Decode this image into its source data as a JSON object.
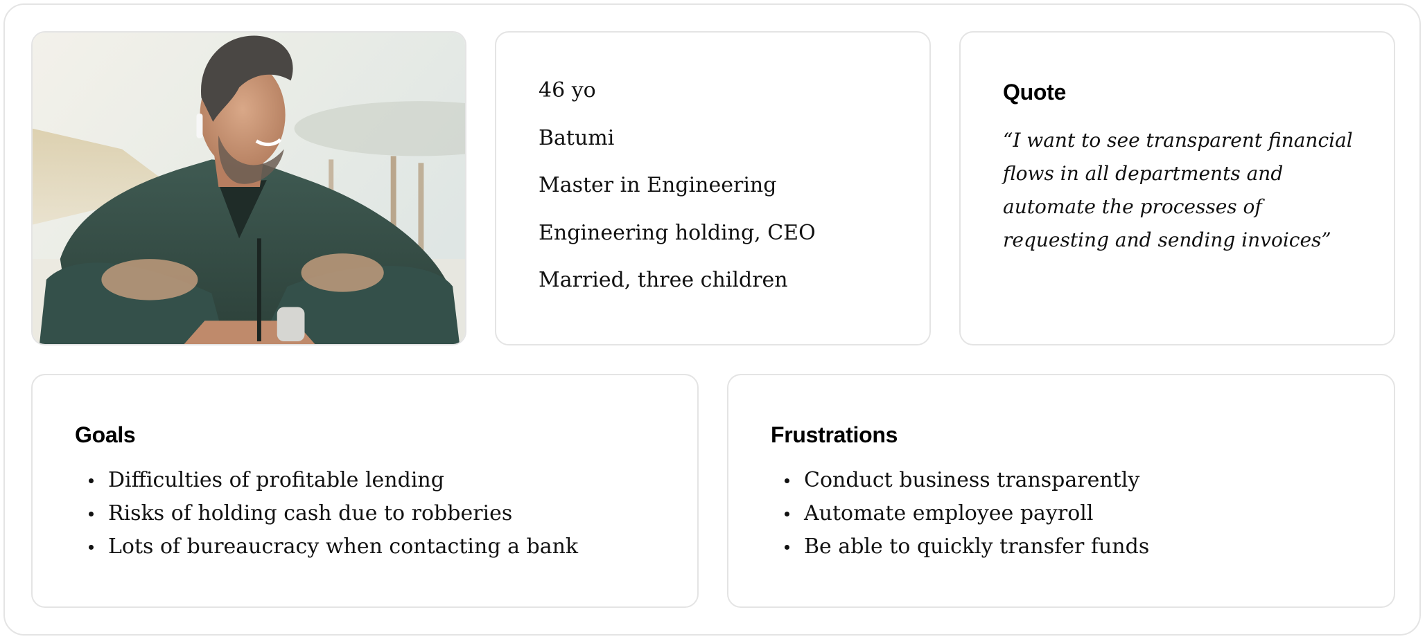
{
  "profile": {
    "photo_description": "man-in-green-jacket-with-earbud-photo",
    "details": [
      "46 yo",
      "Batumi",
      "Master in Engineering",
      "Engineering holding, CEO",
      "Married, three children"
    ]
  },
  "quote": {
    "heading": "Quote",
    "text": "“I want to see transparent financial flows in all departments and automate the processes of requesting and sending invoices”"
  },
  "goals": {
    "heading": "Goals",
    "items": [
      "Difficulties of profitable lending",
      "Risks of holding cash due to robberies",
      "Lots of bureaucracy when contacting a bank"
    ]
  },
  "frustrations": {
    "heading": "Frustrations",
    "items": [
      "Conduct business transparently",
      "Automate employee payroll",
      "Be able to quickly transfer funds"
    ]
  },
  "colors": {
    "border": "#e4e4e4",
    "text": "#111111",
    "background": "#ffffff"
  }
}
